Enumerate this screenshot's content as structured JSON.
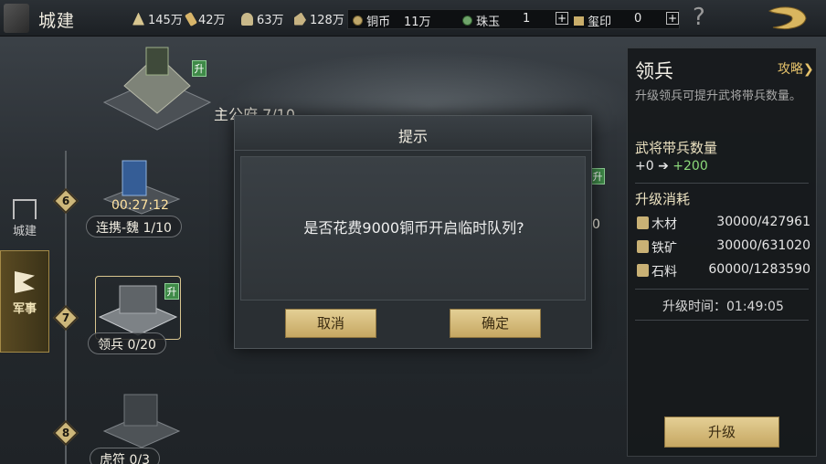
{
  "header": {
    "title": "城建",
    "resources": [
      {
        "name": "wheat-icon",
        "value": "145万",
        "color": "#d8c690"
      },
      {
        "name": "wood-icon",
        "value": "42万",
        "color": "#d8b56a"
      },
      {
        "name": "iron-icon",
        "value": "63万",
        "color": "#c9b98a"
      },
      {
        "name": "stone-icon",
        "value": "128万",
        "color": "#c7b382"
      }
    ],
    "currencies": {
      "copper_label": "铜币",
      "copper_value": "11万",
      "jade_label": "珠玉",
      "jade_value": "1",
      "seal_label": "玺印",
      "seal_value": "0",
      "plus": "+"
    },
    "help": "?"
  },
  "left_tabs": {
    "build": "城建",
    "military": "军事"
  },
  "timeline": {
    "nodes": [
      {
        "num": "6"
      },
      {
        "num": "7"
      },
      {
        "num": "8"
      }
    ],
    "buildings": {
      "main_hall": "主公府 7/10",
      "alliance_name": "连携-魏",
      "alliance_level": "1/10",
      "alliance_timer": "00:27:12",
      "barracks_name": "领兵",
      "barracks_level": "0/20",
      "tiger_name": "虎符",
      "tiger_level": "0/3",
      "hidden_level": "0",
      "upgrade_badge": "升"
    }
  },
  "panel": {
    "title": "领兵",
    "strategy": "攻略",
    "description": "升级领兵可提升武将带兵数量。",
    "troops_title": "武将带兵数量",
    "troops_from": "+0",
    "troops_arrow": "➔",
    "troops_to": "+200",
    "cost_title": "升级消耗",
    "costs": [
      {
        "name": "木材",
        "value": "30000/427961"
      },
      {
        "name": "铁矿",
        "value": "30000/631020"
      },
      {
        "name": "石料",
        "value": "60000/1283590"
      }
    ],
    "time_label": "升级时间：01:49:05",
    "upgrade_button": "升级"
  },
  "dialog": {
    "title": "提示",
    "message": "是否花费9000铜币开启临时队列?",
    "cancel": "取消",
    "confirm": "确定"
  },
  "colors": {
    "accent_gold": "#c6a762",
    "green_value": "#8cd97a",
    "timer": "#ffe2a0"
  }
}
